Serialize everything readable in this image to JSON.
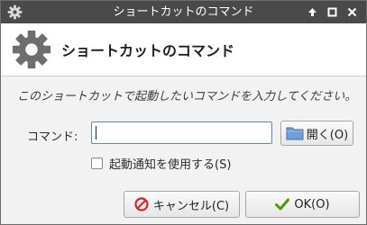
{
  "window": {
    "title": "ショートカットのコマンド"
  },
  "header": {
    "heading": "ショートカットのコマンド",
    "icon": "gear-icon"
  },
  "instruction": "このショートカットで起動したいコマンドを入力してください。",
  "command": {
    "label": "コマンド:",
    "value": "",
    "open_button": "開く(O)"
  },
  "startup_notification": {
    "label": "起動通知を使用する(S)",
    "checked": false
  },
  "buttons": {
    "cancel": "キャンセル(C)",
    "ok": "OK(O)"
  },
  "colors": {
    "titlebar": "#4a4a4a",
    "cancel_icon": "#d9242a",
    "ok_icon": "#4e9a06",
    "folder": "#6fa0d8"
  }
}
